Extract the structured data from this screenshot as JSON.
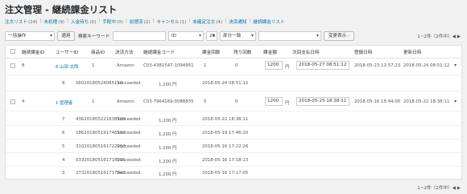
{
  "page": {
    "title": "注文管理 - 継続課金リスト"
  },
  "subnav": [
    {
      "label": "注文リスト",
      "count": "(24)"
    },
    {
      "label": "未処理",
      "count": "(9)"
    },
    {
      "label": "入金待ち",
      "count": "(0)"
    },
    {
      "label": "手配中",
      "count": "(0)"
    },
    {
      "label": "処理済",
      "count": "(2)"
    },
    {
      "label": "キャンセル",
      "count": "(1)"
    },
    {
      "label": "未確定注文",
      "count": "(4)"
    },
    {
      "label": "決済通知",
      "count": ""
    },
    {
      "label": "継続課金リスト",
      "count": ""
    }
  ],
  "toolbar": {
    "bulk_action": "一括操作",
    "apply": "適用",
    "search_placeholder": "検索キーワード",
    "field": "ID",
    "per_page": "20",
    "match": "部分一致",
    "extra": "",
    "display_change": "変更表示 -"
  },
  "pager": {
    "top": "1~2件（2件中）◀ ▶",
    "bottom": "1~2件（2件中）◀ ▶"
  },
  "columns": [
    "継続課金ID",
    "ユーザーID",
    "商品ID",
    "決済方法",
    "継続課金コード",
    "課金回数",
    "残り回数",
    "課金額",
    "次回支払日時",
    "登録日時",
    "更新日時"
  ],
  "orders": [
    {
      "id": "8",
      "user": "6 山田 太郎",
      "product": "1",
      "method": "Amazon",
      "code": "C03-4381547-1094951",
      "count": "1",
      "remain": "0",
      "amount": "1200",
      "unit": "円",
      "next": "2018-05-27 08:51:12",
      "registered": "2018-05-23 12:57:23",
      "updated": "2018-05-24 08:51:12",
      "history": [
        {
          "no": "8",
          "code": "S6020180524085110",
          "status": "Succeeded",
          "amount": "1,200 円",
          "date": "2018-05-24 08:51:12"
        }
      ]
    },
    {
      "id": "4",
      "user": "1 管理者",
      "product": "1",
      "method": "Amazon",
      "code": "C03-7964169-0088835",
      "count": "5",
      "remain": "0",
      "amount": "1200",
      "unit": "円",
      "next": "2018-05-25 18:38:11",
      "registered": "2018-05-16 15:44:00",
      "updated": "2018-05-22 18:38:11",
      "history": [
        {
          "no": "7",
          "code": "436201805221838109",
          "status": "Succeeded",
          "amount": "1,200 円",
          "date": "2018-05-22 18:38:11"
        },
        {
          "no": "6",
          "code": "186201805191746192",
          "status": "Succeeded",
          "amount": "1,200 円",
          "date": "2018-05-19 17:46:20"
        },
        {
          "no": "5",
          "code": "310201805161722250",
          "status": "Succeeded",
          "amount": "1,200 円",
          "date": "2018-05-16 17:22:26"
        },
        {
          "no": "4",
          "code": "033201805161718291",
          "status": "Succeeded",
          "amount": "1,200 円",
          "date": "2018-05-16 17:18:13"
        },
        {
          "no": "3",
          "code": "273201805161717042",
          "status": "Succeeded",
          "amount": "1,200 円",
          "date": "2018-05-16 17:17:05"
        }
      ]
    }
  ]
}
